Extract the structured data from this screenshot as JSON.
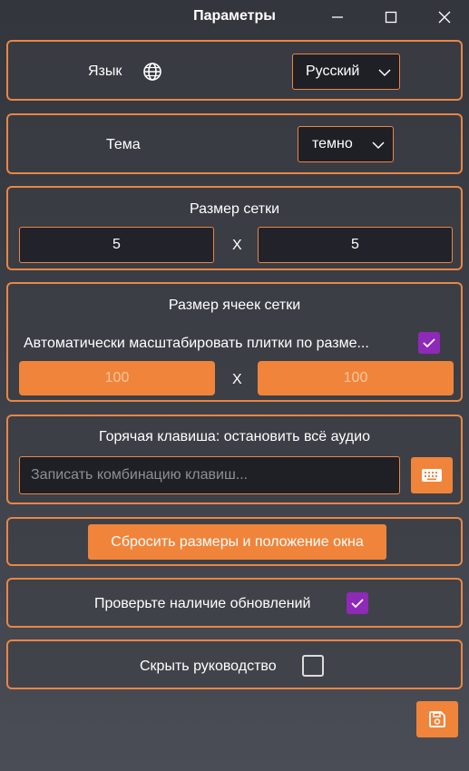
{
  "window": {
    "title": "Параметры"
  },
  "language": {
    "label": "Язык",
    "icon": "globe-icon",
    "selected": "Русский"
  },
  "theme": {
    "label": "Тема",
    "selected": "темно"
  },
  "grid_size": {
    "label": "Размер сетки",
    "rows": "5",
    "separator": "X",
    "cols": "5"
  },
  "cell_size": {
    "label": "Размер ячеек сетки",
    "auto_scale_label": "Автоматически масштабировать плитки по разме...",
    "auto_scale_checked": true,
    "width": "100",
    "separator": "X",
    "height": "100"
  },
  "hotkey": {
    "label": "Горячая клавиша: остановить всё аудио",
    "placeholder": "Записать комбинацию клавиш...",
    "button_icon": "keyboard-icon"
  },
  "reset": {
    "label": "Сбросить размеры и положение окна"
  },
  "updates": {
    "label": "Проверьте наличие обновлений",
    "checked": true
  },
  "hide_guide": {
    "label": "Скрыть руководство",
    "checked": false
  },
  "save": {
    "icon": "save-icon"
  },
  "colors": {
    "accent": "#f0843a",
    "border": "#e98644",
    "checkbox": "#8e29b8",
    "background": "#3a3c43"
  }
}
